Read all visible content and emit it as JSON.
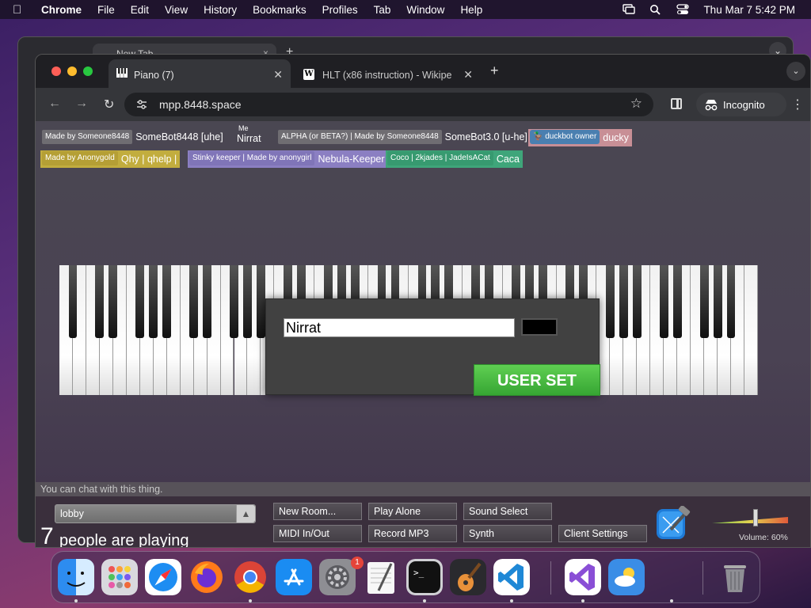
{
  "menubar": {
    "app": "Chrome",
    "items": [
      "File",
      "Edit",
      "View",
      "History",
      "Bookmarks",
      "Profiles",
      "Tab",
      "Window",
      "Help"
    ],
    "clock": "Thu Mar 7  5:42 PM"
  },
  "background_window": {
    "tab_title": "New Tab"
  },
  "tabs": [
    {
      "title": "Piano (7)"
    },
    {
      "title": "HLT (x86 instruction) - Wikipe"
    }
  ],
  "toolbar": {
    "url": "mpp.8448.space",
    "incognito_label": "Incognito"
  },
  "users": [
    {
      "badge": "Made by Someone8448",
      "name": "SomeBot8448 [uhe]",
      "badge_bg": "#6f6d72",
      "text_bg": "transparent",
      "name_color": "#ffffff"
    },
    {
      "badge": "Me",
      "name": "Nirrat",
      "badge_bg": "transparent",
      "text_bg": "transparent",
      "name_color": "#ffffff"
    },
    {
      "badge": "ALPHA (or BETA?) | Made by Someone8448",
      "name": "SomeBot3.0 [u-he]",
      "badge_bg": "#6f6d72",
      "text_bg": "transparent",
      "name_color": "#ffffff"
    },
    {
      "badge": "duckbot owner",
      "name": "ducky",
      "badge_bg": "#4a7fb0",
      "text_bg": "#c88f96",
      "name_color": "#ffffff"
    },
    {
      "badge": "Made by Anonygold",
      "name": "Qhy | qhelp |",
      "badge_bg": "#c2ad3e",
      "text_bg": "#c2ad3e",
      "name_color": "#ffffff"
    },
    {
      "badge": "Stinky keeper | Made by anonygirl",
      "name": "Nebula-Keeper",
      "badge_bg": "#8b7fc2",
      "text_bg": "#8b7fc2",
      "name_color": "#ffffff"
    },
    {
      "badge": "Coco | 2kjades | JadeIsACat",
      "name": "Caca",
      "badge_bg": "#3fa57a",
      "text_bg": "#3fa57a",
      "name_color": "#ffffff"
    }
  ],
  "modal": {
    "name_value": "Nirrat",
    "color_value": "#000000",
    "submit_label": "USER SET"
  },
  "chat": {
    "placeholder": "You can chat with this thing."
  },
  "footer": {
    "room": "lobby",
    "player_count": "7",
    "player_label": "people are playing",
    "buttons": {
      "new_room": "New Room...",
      "play_alone": "Play Alone",
      "sound_select": "Sound Select",
      "midi": "MIDI In/Out",
      "record": "Record MP3",
      "synth": "Synth",
      "client_settings": "Client Settings"
    },
    "volume_label": "Volume: 60%",
    "volume_level": 0.6
  },
  "dock": {
    "apps": [
      "finder-icon",
      "launchpad-icon",
      "safari-icon",
      "firefox-icon",
      "chrome-icon",
      "app-store-icon",
      "system-settings-icon",
      "textedit-icon",
      "terminal-icon",
      "garageband-icon",
      "vscode-icon",
      "visual-studio-icon",
      "weather-icon",
      "trash-icon"
    ],
    "settings_badge": "1"
  }
}
